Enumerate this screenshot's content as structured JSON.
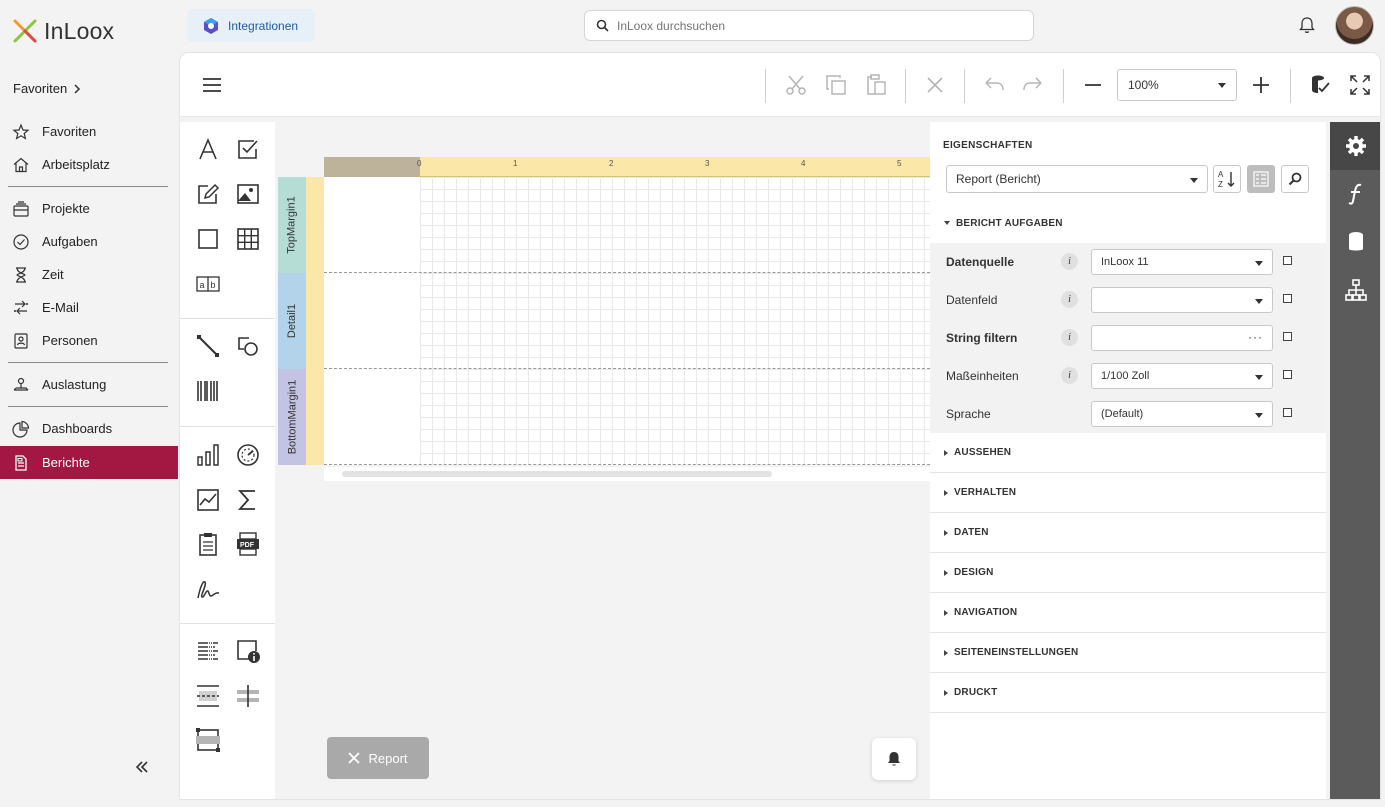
{
  "app": {
    "name": "InLoox"
  },
  "header": {
    "integrations_label": "Integrationen",
    "search_placeholder": "InLoox durchsuchen"
  },
  "sidebar": {
    "favorites_header": "Favoriten",
    "items": [
      {
        "label": "Favoriten",
        "icon": "star-icon"
      },
      {
        "label": "Arbeitsplatz",
        "icon": "home-icon"
      },
      {
        "label": "Projekte",
        "icon": "projects-icon"
      },
      {
        "label": "Aufgaben",
        "icon": "check-circle-icon"
      },
      {
        "label": "Zeit",
        "icon": "hourglass-icon"
      },
      {
        "label": "E-Mail",
        "icon": "email-icon"
      },
      {
        "label": "Personen",
        "icon": "contact-icon"
      },
      {
        "label": "Auslastung",
        "icon": "workload-icon"
      },
      {
        "label": "Dashboards",
        "icon": "pie-chart-icon"
      },
      {
        "label": "Berichte",
        "icon": "report-icon",
        "active": true
      }
    ]
  },
  "toolbar": {
    "zoom_value": "100%"
  },
  "designer": {
    "bands": [
      "TopMargin1",
      "Detail1",
      "BottomMargin1"
    ],
    "ruler_labels": [
      "0",
      "1",
      "2",
      "3",
      "4",
      "5"
    ],
    "report_tab_label": "Report"
  },
  "properties": {
    "title": "EIGENSCHAFTEN",
    "selected_object": "Report (Bericht)",
    "tasks_section": "BERICHT AUFGABEN",
    "rows": [
      {
        "label": "Datenquelle",
        "value": "InLoox 11",
        "bold": true
      },
      {
        "label": "Datenfeld",
        "value": "",
        "bold": false
      },
      {
        "label": "String filtern",
        "value": "",
        "bold": true
      },
      {
        "label": "Maßeinheiten",
        "value": "1/100 Zoll",
        "bold": false
      },
      {
        "label": "Sprache",
        "value": "(Default)",
        "bold": false
      }
    ],
    "sections": [
      "AUSSEHEN",
      "VERHALTEN",
      "DATEN",
      "DESIGN",
      "NAVIGATION",
      "SEITENEINSTELLUNGEN",
      "DRUCKT"
    ],
    "info_glyph": "i",
    "ellipsis": "···"
  },
  "colors": {
    "accent": "#a31743",
    "rail": "#5b5b5b",
    "ruler": "#fbe7a8",
    "band_top": "#b5ddd6",
    "band_detail": "#b2d3ea",
    "band_bottom": "#c3c3e3"
  }
}
